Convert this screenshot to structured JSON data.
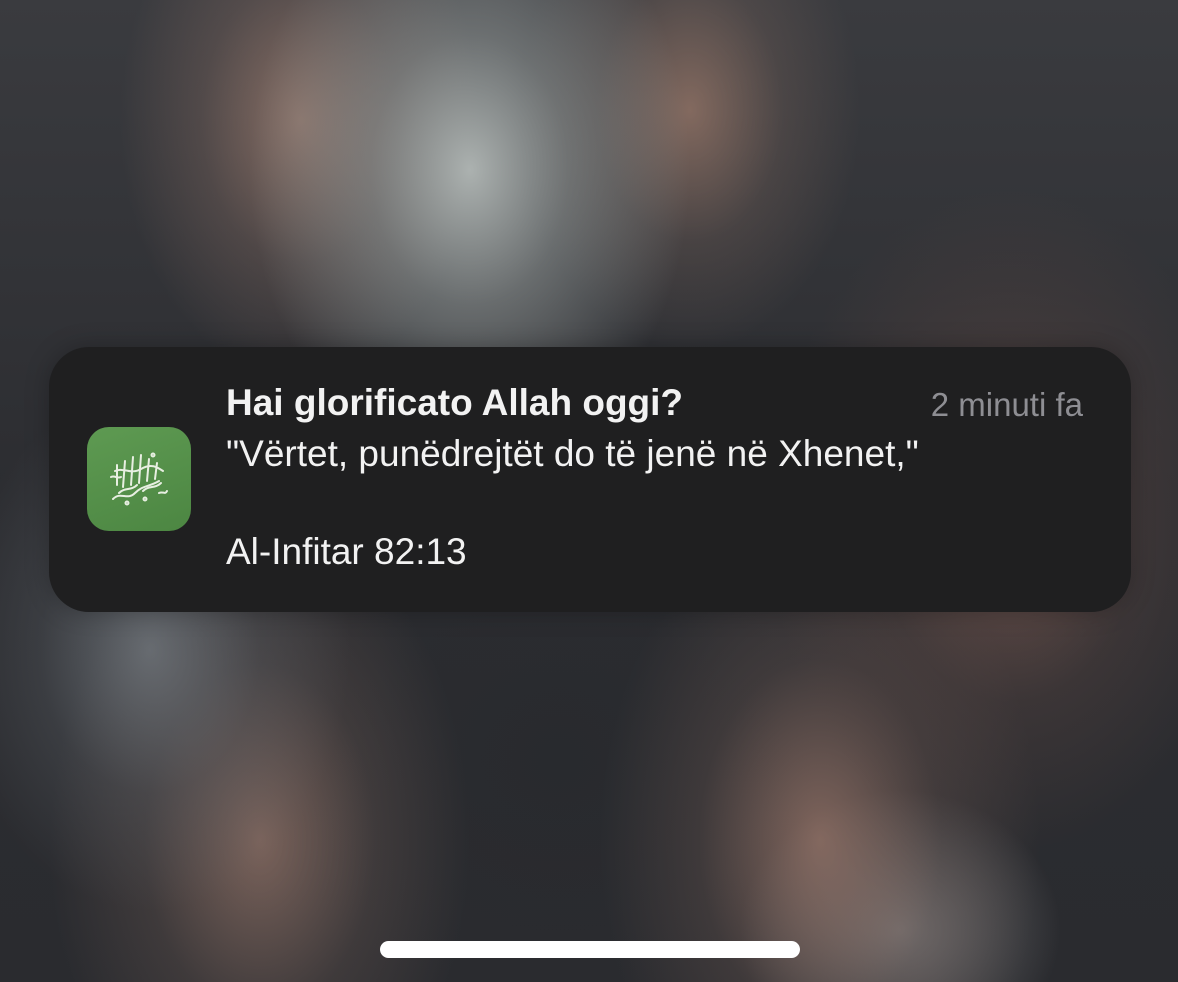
{
  "notification": {
    "title": "Hai glorificato Allah oggi?",
    "time": "2 minuti fa",
    "body": "\"Vërtet, punëdrejtët do të jenë në Xhenet,\"",
    "reference": "Al-Infitar 82:13",
    "app_icon": "quran-app-icon",
    "accent_color": "#4f8a45"
  }
}
